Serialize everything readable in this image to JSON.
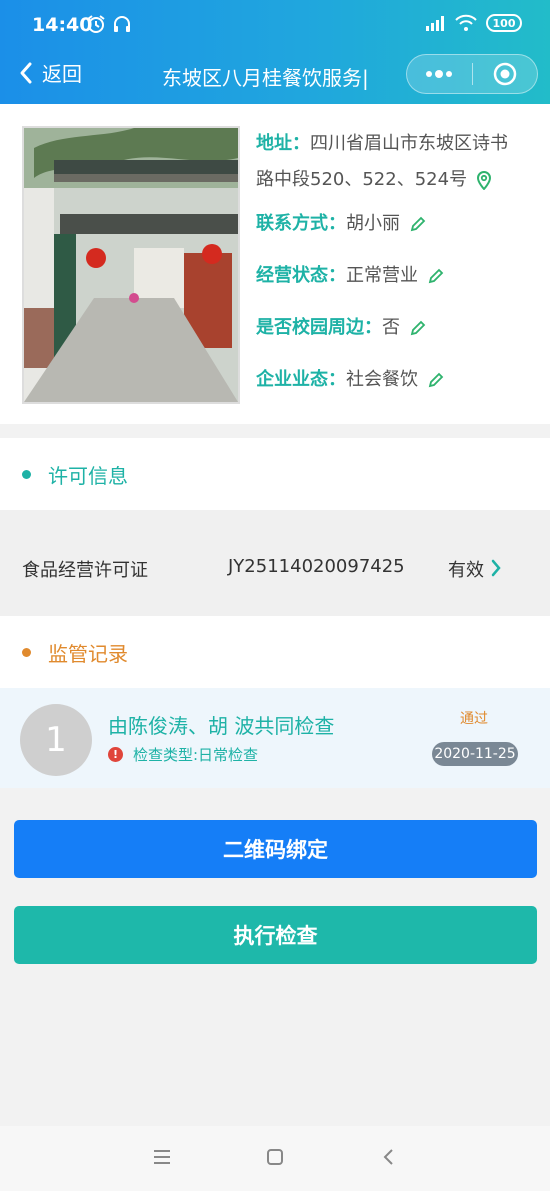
{
  "status_bar": {
    "time": "14:40",
    "battery": "100"
  },
  "nav": {
    "back_label": "返回",
    "title": "东坡区八月桂餐饮服务|"
  },
  "shop": {
    "photo_alt": "店铺门头照片",
    "address_label": "地址：",
    "address_line1": "四川省眉山市东坡区诗书",
    "address_line2": "路中段520、522、524号",
    "contact_label": "联系方式：",
    "contact_value": "胡小丽",
    "status_label": "经营状态：",
    "status_value": "正常营业",
    "campus_label": "是否校园周边：",
    "campus_value": "否",
    "type_label": "企业业态：",
    "type_value": "社会餐饮"
  },
  "license_section": {
    "title": "许可信息",
    "name": "食品经营许可证",
    "number": "JY25114020097425",
    "validity": "有效"
  },
  "record_section": {
    "title": "监管记录",
    "records": [
      {
        "index": "1",
        "title": "由陈俊涛、胡 波共同检查",
        "type": "检查类型:日常检查",
        "result": "通过",
        "date": "2020-11-25"
      }
    ]
  },
  "buttons": {
    "bind_qr": "二维码绑定",
    "inspect": "执行检查"
  },
  "colors": {
    "teal": "#1eb2a6",
    "blue": "#157ef7",
    "orange": "#e08a2e",
    "header_start": "#1b8fe8",
    "header_end": "#22bcc9"
  }
}
